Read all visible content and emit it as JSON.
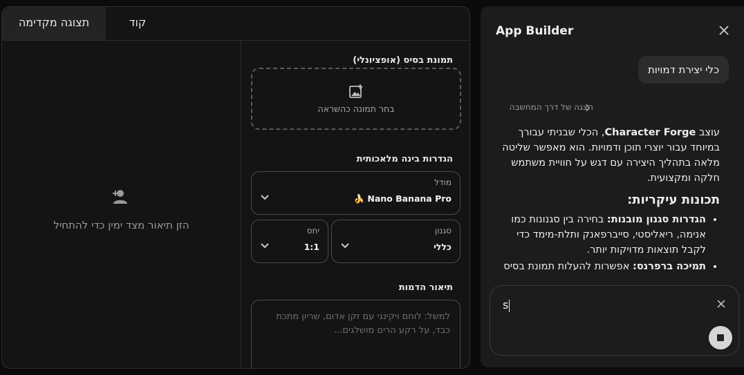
{
  "tabs": {
    "preview_label": "תצוגה מקדימה",
    "code_label": "קוד"
  },
  "preview": {
    "empty_message": "הזן תיאור מצד ימין כדי להתחיל",
    "icon": "person-add-icon"
  },
  "form": {
    "base_image": {
      "label": "תמונת בסיס (אופציונלי)",
      "upload_text": "בחר תמונה כהשראה",
      "icon": "add-photo-icon"
    },
    "ai_settings_label": "הגדרות בינה מלאכותית",
    "model": {
      "label": "מודל",
      "value": "Nano Banana Pro 🍌"
    },
    "style": {
      "label": "סגנון",
      "value": "כללי"
    },
    "ratio": {
      "label": "יחס",
      "value": "1:1"
    },
    "character_description": {
      "label": "תיאור הדמות",
      "placeholder": "למשל: לוחם ויקינגי עם זקן אדום, שריון מתכת כבד, על רקע הרים מושלגים..."
    }
  },
  "builder": {
    "title": "App Builder",
    "user_message": "כלי יצירת דמויות",
    "thought_label": "הצגה של דרך המחשבה",
    "reply": {
      "intro_before": "עוצב ",
      "intro_bold": "Character Forge",
      "intro_after": ", הכלי שבניתי עבורך במיוחד עבור יוצרי תוכן ודמויות. הוא מאפשר שליטה מלאה בתהליך היצירה עם דגש על חוויית משתמש חלקה ומקצועית.",
      "features_heading": "תכונות עיקריות:",
      "features": [
        {
          "bold": "הגדרות סגנון מובנות:",
          "text": " בחירה בין סגנונות כמו אנימה, ריאליסטי, סייברפאנק ותלת-מימד כדי לקבל תוצאות מדויקות יותר."
        },
        {
          "bold": "תמיכה ברפרנס:",
          "text": " אפשרות להעלות תמונת בסיס"
        }
      ]
    },
    "composer_text": "s"
  },
  "colors": {
    "background": "#0b0b0b",
    "panel": "#141414",
    "builder_panel": "#1c1c1c",
    "active_tab": "#232323"
  }
}
